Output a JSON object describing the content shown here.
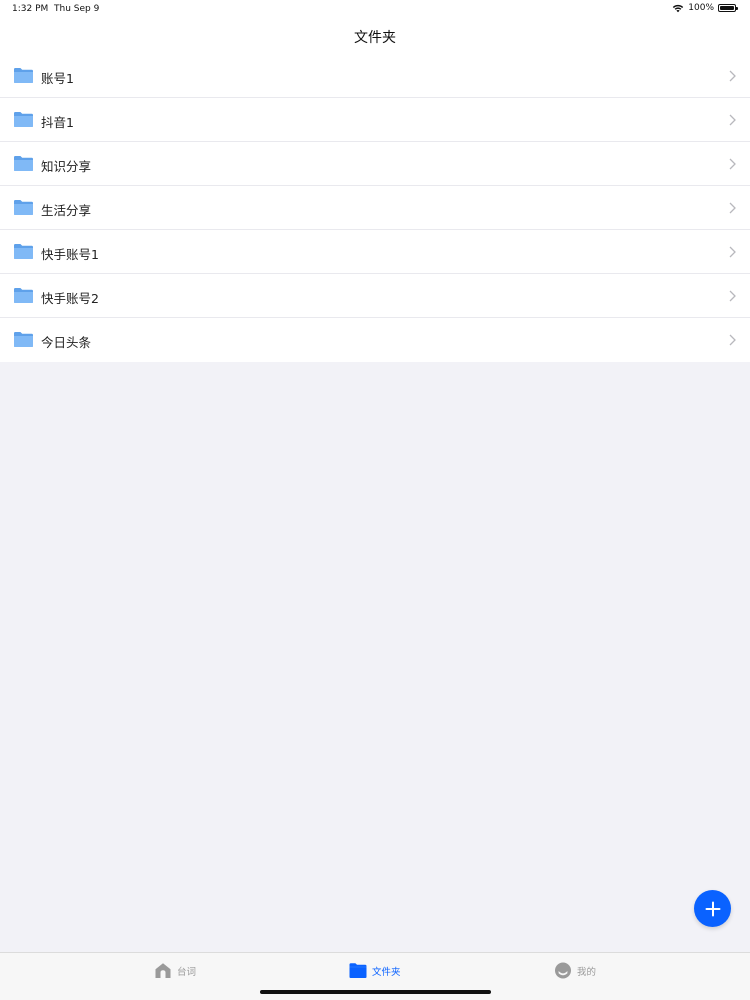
{
  "status_bar": {
    "time": "1:32 PM",
    "date": "Thu Sep 9",
    "battery": "100%"
  },
  "nav": {
    "title": "文件夹"
  },
  "folders": [
    {
      "name": "账号1"
    },
    {
      "name": "抖音1"
    },
    {
      "name": "知识分享"
    },
    {
      "name": "生活分享"
    },
    {
      "name": "快手账号1"
    },
    {
      "name": "快手账号2"
    },
    {
      "name": "今日头条"
    }
  ],
  "tabs": [
    {
      "label": "台词",
      "icon": "home-icon",
      "active": false
    },
    {
      "label": "文件夹",
      "icon": "folder-icon",
      "active": true
    },
    {
      "label": "我的",
      "icon": "profile-icon",
      "active": false
    }
  ],
  "colors": {
    "accent": "#0a62ff",
    "folder": "#7fb6f5",
    "background": "#f2f2f7"
  }
}
